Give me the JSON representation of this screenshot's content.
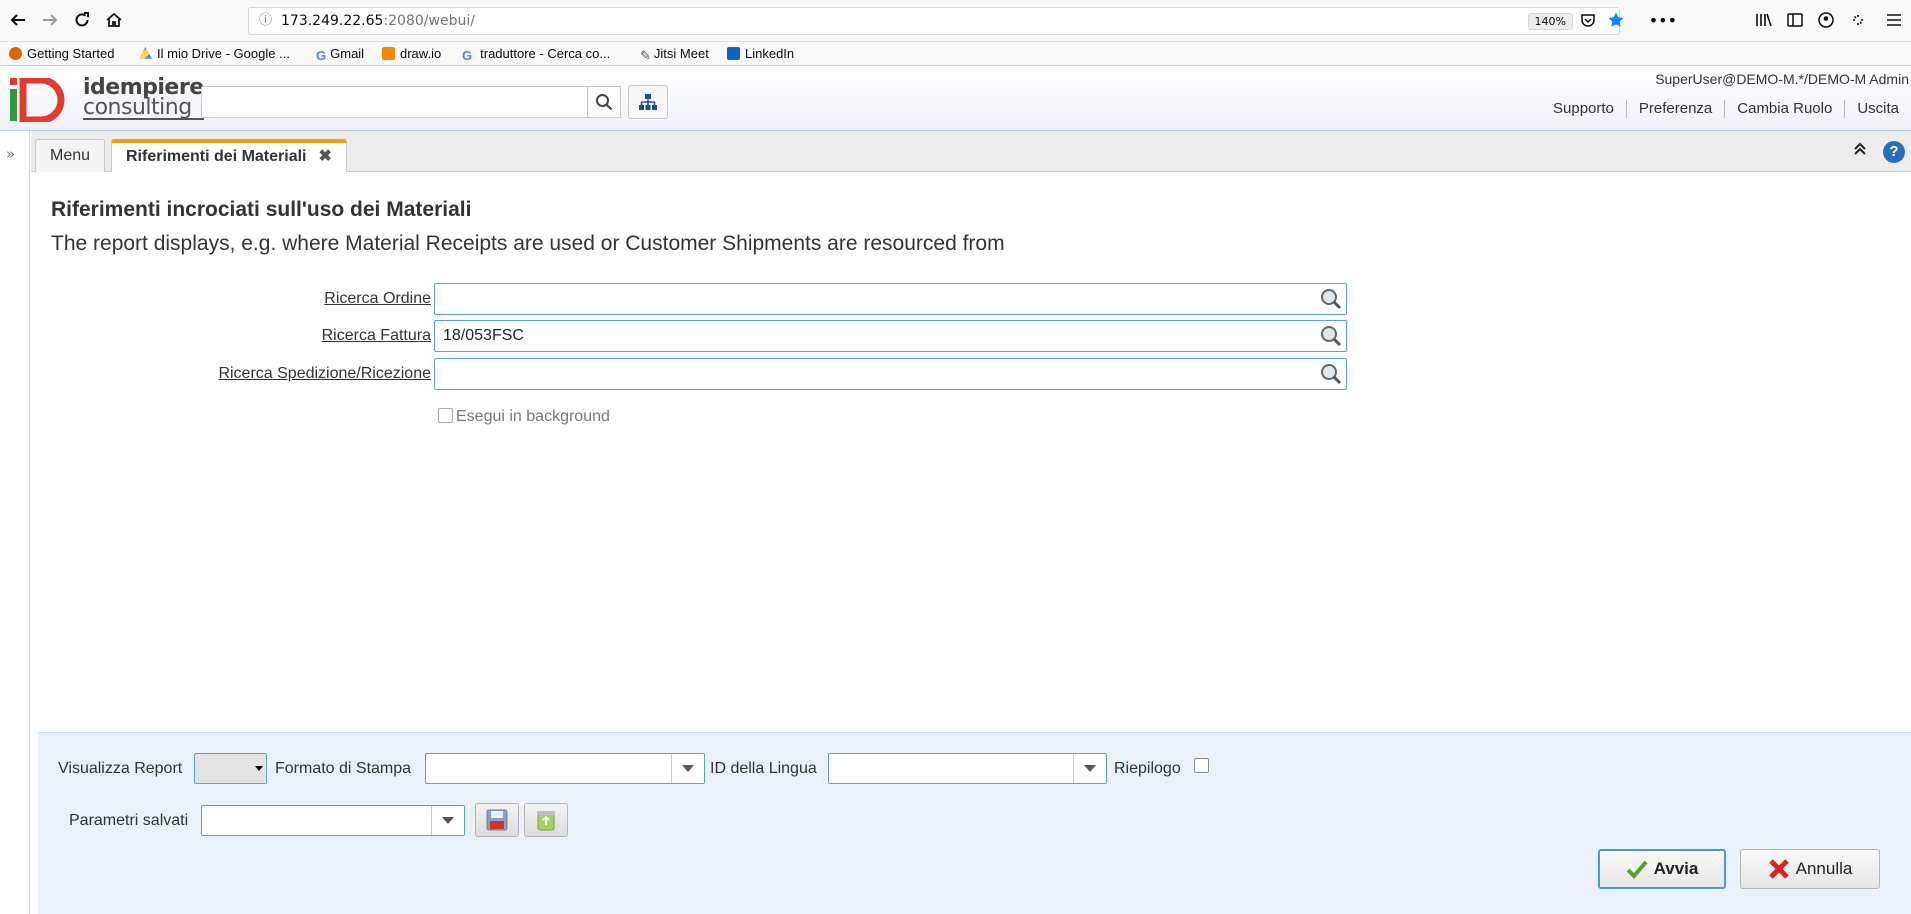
{
  "browser": {
    "url_host": "173.249.22.65",
    "url_rest": ":2080/webui/",
    "zoom": "140%",
    "bookmarks": [
      {
        "label": "Getting Started",
        "color": "#e66000"
      },
      {
        "label": "Il mio Drive - Google ...",
        "color": "#1fa463"
      },
      {
        "label": "Gmail",
        "color": "#4285f4"
      },
      {
        "label": "draw.io",
        "color": "#f08705"
      },
      {
        "label": "traduttore - Cerca co...",
        "color": "#4285f4"
      },
      {
        "label": "Jitsi Meet",
        "color": "#555555"
      },
      {
        "label": "LinkedIn",
        "color": "#0a66c2"
      }
    ]
  },
  "app": {
    "logo_line1": "idempiere",
    "logo_line2": "consulting",
    "user": "SuperUser@DEMO-M.*/DEMO-M Admin",
    "links": {
      "support": "Supporto",
      "prefs": "Preferenza",
      "role": "Cambia Ruolo",
      "exit": "Uscita"
    }
  },
  "tabs": {
    "menu": "Menu",
    "active": "Riferimenti dei Materiali"
  },
  "form": {
    "title": "Riferimenti incrociati sull'uso dei Materiali",
    "description": "The report displays, e.g. where Material Receipts are used or Customer Shipments are resourced from",
    "fields": {
      "order_label": "Ricerca Ordine",
      "order_value": "",
      "invoice_label": "Ricerca Fattura",
      "invoice_value": "18/053FSC",
      "shipment_label": "Ricerca Spedizione/Ricezione",
      "shipment_value": ""
    },
    "background_label": "Esegui in background"
  },
  "bottom": {
    "report_label": "Visualizza Report",
    "print_format_label": "Formato di Stampa",
    "language_label": "ID della Lingua",
    "summary_label": "Riepilogo",
    "saved_params_label": "Parametri salvati",
    "ok_label": "Avvia",
    "cancel_label": "Annulla"
  },
  "colors": {
    "accent": "#f39c12",
    "focus": "#5aa0d8",
    "panel": "#eaf1fb"
  }
}
